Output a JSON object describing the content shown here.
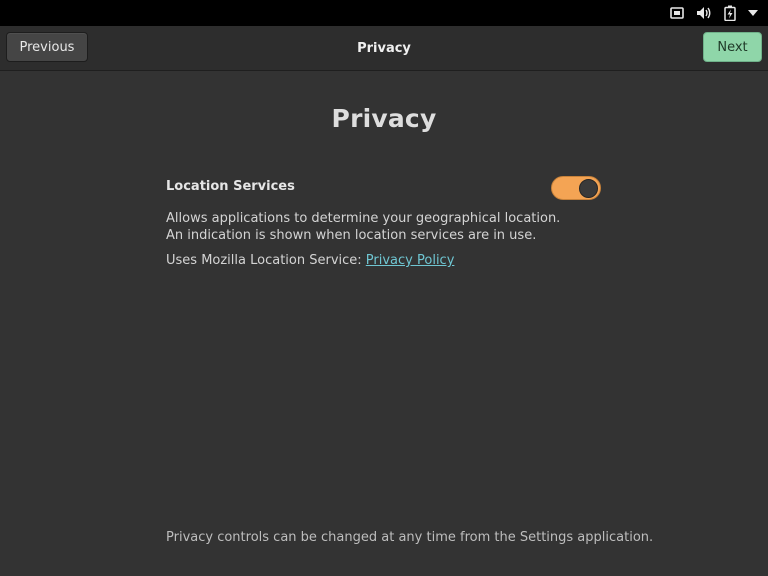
{
  "system_tray": {
    "icons": [
      "network-wired-icon",
      "volume-icon",
      "battery-charging-icon",
      "menu-arrow-icon"
    ]
  },
  "header": {
    "previous_label": "Previous",
    "title": "Privacy",
    "next_label": "Next"
  },
  "page": {
    "title": "Privacy",
    "location": {
      "label": "Location Services",
      "enabled": true,
      "description": "Allows applications to determine your geographical location. An indication is shown when location services are in use.",
      "source_prefix": "Uses Mozilla Location Service: ",
      "link_text": "Privacy Policy"
    },
    "footer_note": "Privacy controls can be changed at any time from the Settings application."
  },
  "colors": {
    "accent_toggle": "#f4a454",
    "next_button": "#8fd6a9",
    "link": "#6fc6d2",
    "window_bg": "#333333"
  }
}
